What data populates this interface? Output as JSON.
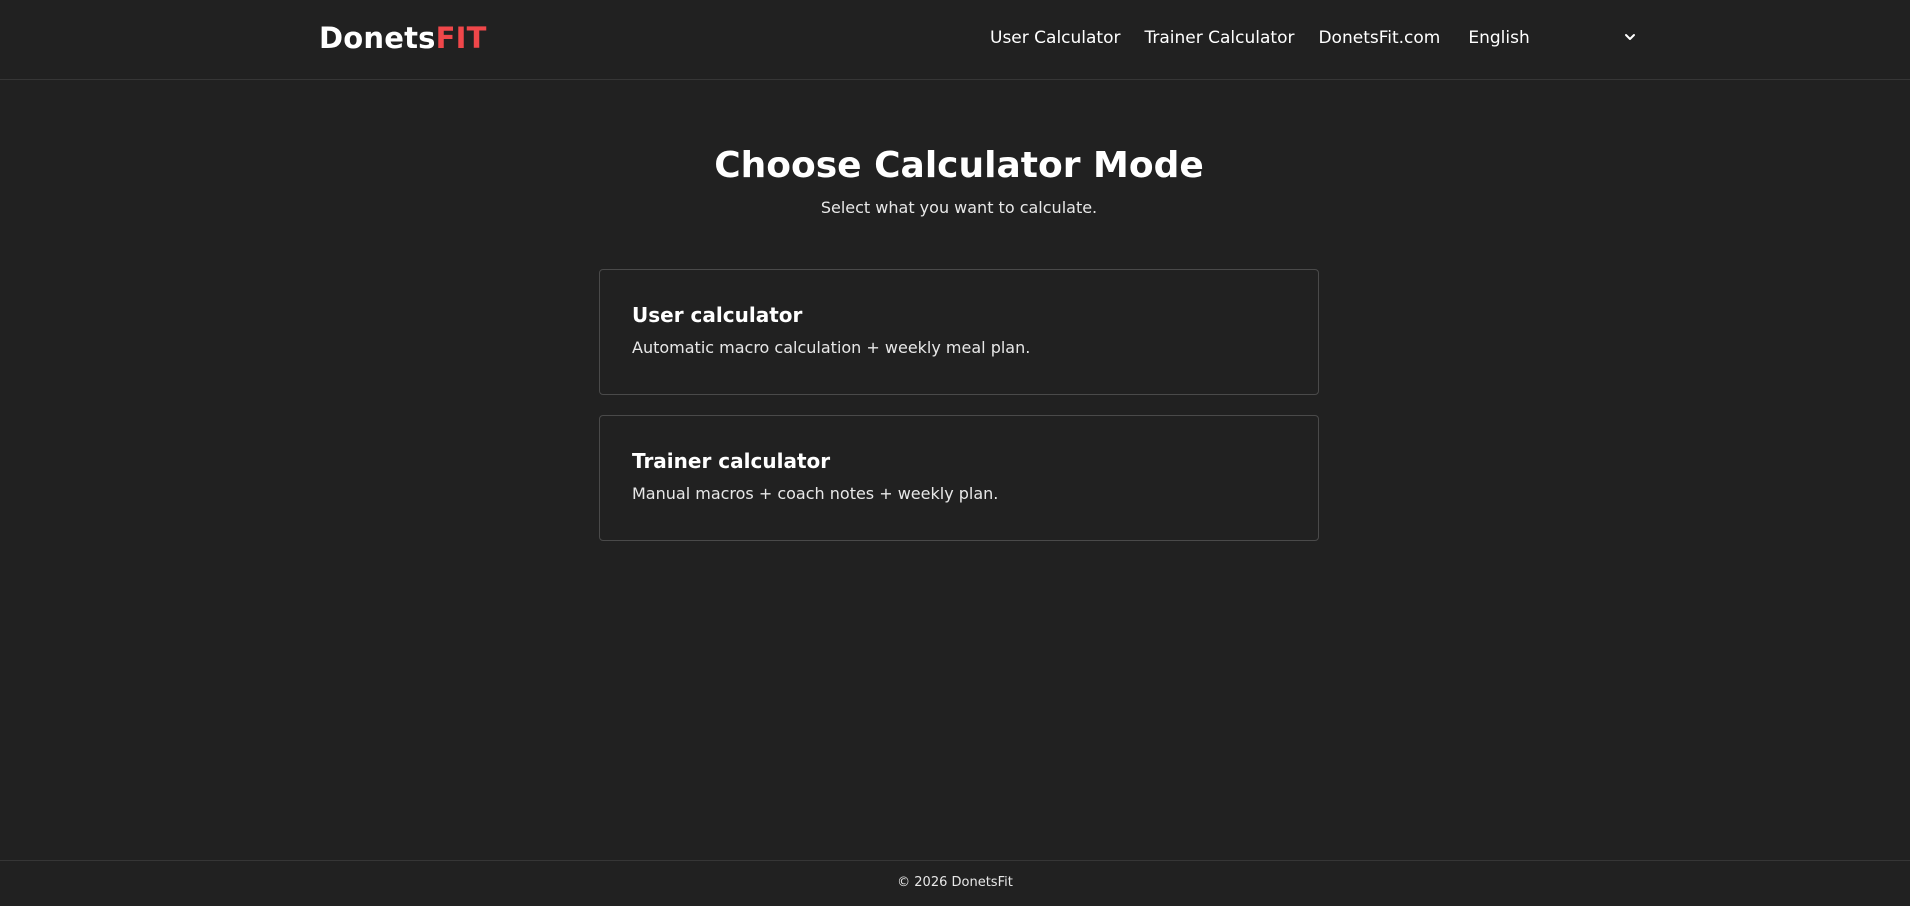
{
  "brand": {
    "name_main": "Donets",
    "name_accent": "FIT",
    "accent_color": "#f0474a"
  },
  "nav": {
    "links": [
      {
        "label": "User Calculator"
      },
      {
        "label": "Trainer Calculator"
      },
      {
        "label": "DonetsFit.com"
      }
    ],
    "language": {
      "selected": "English",
      "icon": "chevron-down-icon"
    }
  },
  "main": {
    "title": "Choose Calculator Mode",
    "subtitle": "Select what you want to calculate.",
    "cards": [
      {
        "title": "User calculator",
        "description": "Automatic macro calculation + weekly meal plan."
      },
      {
        "title": "Trainer calculator",
        "description": "Manual macros + coach notes + weekly plan."
      }
    ]
  },
  "footer": {
    "copyright": "© 2026 DonetsFit"
  },
  "colors": {
    "background": "#212121",
    "border": "#4a4a4a",
    "text": "#ffffff"
  }
}
